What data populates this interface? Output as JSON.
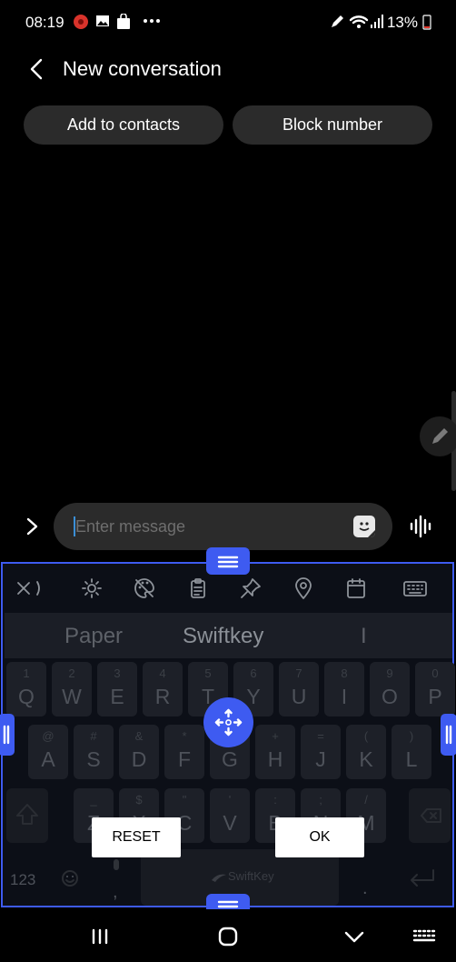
{
  "status_bar": {
    "time": "08:19",
    "battery_pct": "13%",
    "left_icons": [
      "red-app-icon",
      "image-icon",
      "shopping-bag-icon",
      "more-dots-icon"
    ],
    "right_icons": [
      "pen-icon",
      "wifi-icon",
      "signal-icon",
      "battery-icon"
    ]
  },
  "header": {
    "title": "New conversation"
  },
  "actions": {
    "add_contacts": "Add to contacts",
    "block_number": "Block number"
  },
  "compose": {
    "placeholder": "Enter message"
  },
  "keyboard": {
    "suggestions": [
      "Paper",
      "Swiftkey",
      "I"
    ],
    "row1": [
      {
        "main": "Q",
        "alt": "1"
      },
      {
        "main": "W",
        "alt": "2"
      },
      {
        "main": "E",
        "alt": "3"
      },
      {
        "main": "R",
        "alt": "4"
      },
      {
        "main": "T",
        "alt": "5"
      },
      {
        "main": "Y",
        "alt": "6"
      },
      {
        "main": "U",
        "alt": "7"
      },
      {
        "main": "I",
        "alt": "8"
      },
      {
        "main": "O",
        "alt": "9"
      },
      {
        "main": "P",
        "alt": "0"
      }
    ],
    "row2": [
      {
        "main": "A",
        "alt": "@"
      },
      {
        "main": "S",
        "alt": "#"
      },
      {
        "main": "D",
        "alt": "&"
      },
      {
        "main": "F",
        "alt": "*"
      },
      {
        "main": "G",
        "alt": "-"
      },
      {
        "main": "H",
        "alt": "+"
      },
      {
        "main": "J",
        "alt": "="
      },
      {
        "main": "K",
        "alt": "("
      },
      {
        "main": "L",
        "alt": ")"
      }
    ],
    "row3": [
      {
        "main": "Z",
        "alt": "_"
      },
      {
        "main": "X",
        "alt": "$"
      },
      {
        "main": "C",
        "alt": "\""
      },
      {
        "main": "V",
        "alt": "'"
      },
      {
        "main": "B",
        "alt": ":"
      },
      {
        "main": "N",
        "alt": ";"
      },
      {
        "main": "M",
        "alt": "/"
      }
    ],
    "num_label": "123",
    "comma_label": ",",
    "period_label": ".",
    "space_brand": "SwiftKey",
    "reset_label": "RESET",
    "ok_label": "OK"
  },
  "colors": {
    "accent": "#3e5bf1",
    "pill_bg": "#2b2b2b",
    "keyboard_bg": "#0c0f17"
  }
}
